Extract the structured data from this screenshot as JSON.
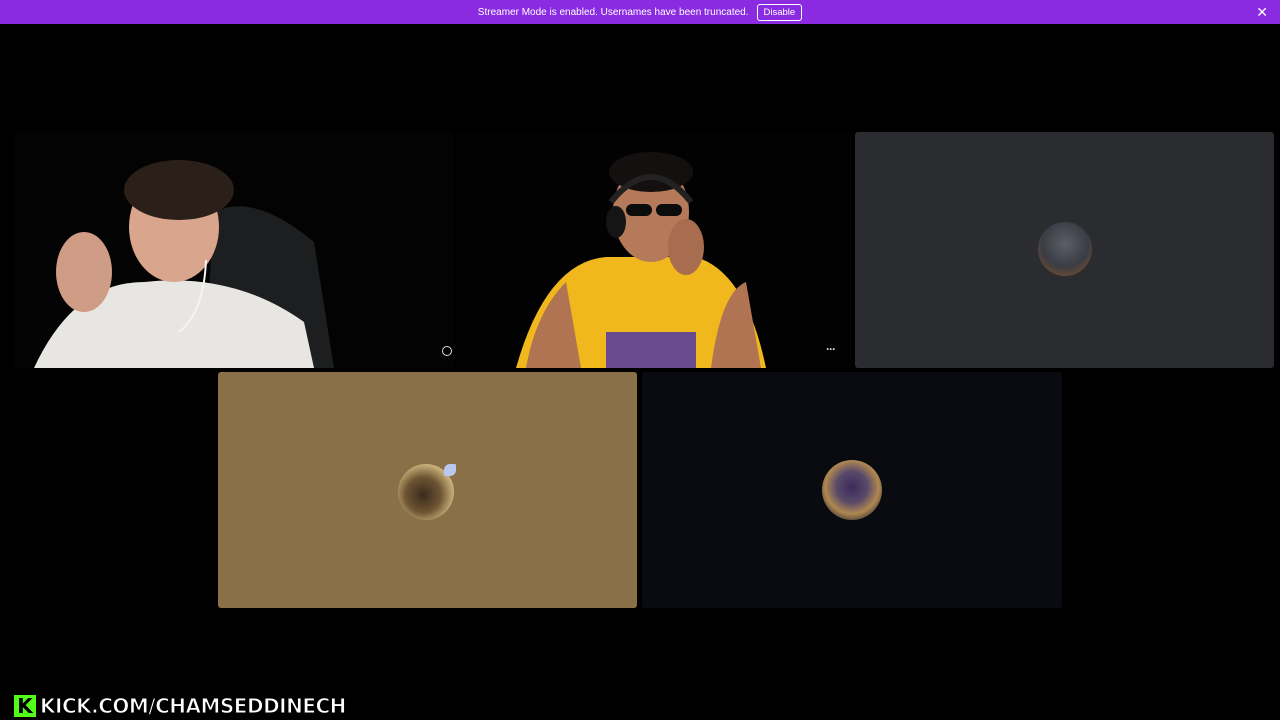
{
  "banner": {
    "message": "Streamer Mode is enabled. Usernames have been truncated.",
    "disable_label": "Disable",
    "close_glyph": "✕",
    "color": "#8a2be2"
  },
  "tiles": [
    {
      "name": "participant-1-camera",
      "type": "video"
    },
    {
      "name": "participant-2-camera",
      "type": "video"
    },
    {
      "name": "participant-3-tile",
      "type": "avatar",
      "background": "#2b2c30"
    },
    {
      "name": "participant-4-tile",
      "type": "avatar",
      "background": "#8a7048"
    },
    {
      "name": "participant-5-tile",
      "type": "avatar",
      "background": "#0a0b10"
    }
  ],
  "controls": {
    "more_glyph": "···"
  },
  "watermark": {
    "logo_letter": "K",
    "text": "KICK.COM/CHAMSEDDINECH"
  }
}
